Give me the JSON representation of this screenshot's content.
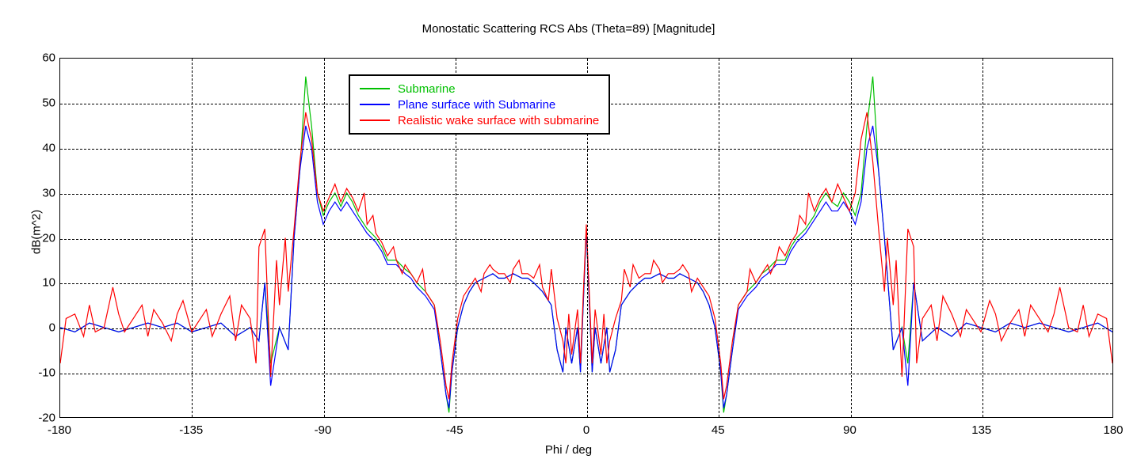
{
  "chart_data": {
    "type": "line",
    "title": "Monostatic Scattering RCS Abs (Theta=89) [Magnitude]",
    "xlabel": "Phi / deg",
    "ylabel": "dB(m^2)",
    "xlim": [
      -180,
      180
    ],
    "ylim": [
      -20,
      60
    ],
    "xticks": [
      -180,
      -135,
      -90,
      -45,
      0,
      45,
      90,
      135,
      180
    ],
    "yticks": [
      -20,
      -10,
      0,
      10,
      20,
      30,
      40,
      50,
      60
    ],
    "legend_position": "top-center",
    "grid": true,
    "series": [
      {
        "name": "Submarine",
        "color": "#00c000",
        "x": [
          -180,
          -175,
          -170,
          -165,
          -160,
          -155,
          -150,
          -145,
          -140,
          -135,
          -130,
          -125,
          -120,
          -115,
          -112,
          -110,
          -108,
          -105,
          -102,
          -100,
          -98,
          -96,
          -94,
          -92,
          -90,
          -88,
          -86,
          -84,
          -82,
          -80,
          -78,
          -75,
          -72,
          -70,
          -68,
          -65,
          -62,
          -60,
          -58,
          -55,
          -52,
          -50,
          -48,
          -47,
          -46,
          -45,
          -44,
          -42,
          -40,
          -38,
          -35,
          -32,
          -30,
          -28,
          -25,
          -22,
          -20,
          -18,
          -15,
          -12,
          -10,
          -8,
          -7,
          -5,
          -3,
          -2,
          0,
          2,
          3,
          5,
          7,
          8,
          10,
          12,
          15,
          18,
          20,
          22,
          25,
          28,
          30,
          32,
          35,
          38,
          40,
          42,
          44,
          45,
          46,
          47,
          48,
          50,
          52,
          55,
          58,
          60,
          62,
          65,
          68,
          70,
          72,
          75,
          78,
          80,
          82,
          84,
          86,
          88,
          90,
          92,
          94,
          96,
          98,
          100,
          102,
          105,
          108,
          110,
          112,
          115,
          120,
          125,
          130,
          135,
          140,
          145,
          150,
          155,
          160,
          165,
          170,
          175,
          180
        ],
        "values": [
          0,
          -1,
          1,
          0,
          -1,
          0,
          1,
          0,
          1,
          -1,
          0,
          1,
          -2,
          0,
          -3,
          10,
          -8,
          0,
          -5,
          20,
          35,
          56,
          45,
          30,
          25,
          28,
          30,
          27,
          30,
          28,
          25,
          22,
          20,
          18,
          15,
          15,
          13,
          12,
          10,
          8,
          5,
          -5,
          -15,
          -19,
          -10,
          -5,
          0,
          5,
          8,
          10,
          11,
          12,
          11,
          11,
          12,
          11,
          11,
          10,
          8,
          5,
          -5,
          -10,
          0,
          -8,
          0,
          -10,
          22,
          -10,
          0,
          -8,
          0,
          -10,
          -5,
          5,
          8,
          10,
          11,
          11,
          12,
          11,
          11,
          12,
          11,
          10,
          8,
          5,
          0,
          -5,
          -10,
          -19,
          -15,
          -5,
          5,
          8,
          10,
          12,
          13,
          15,
          15,
          18,
          20,
          22,
          25,
          28,
          30,
          28,
          27,
          30,
          28,
          25,
          30,
          45,
          56,
          35,
          20,
          -5,
          0,
          -8,
          10,
          -3,
          0,
          -2,
          1,
          0,
          -1,
          1,
          0,
          1,
          0,
          -1,
          0,
          1,
          -1,
          0
        ],
        "note": "RCS pattern symmetric about 0; sharp peaks ~±96° up to 56 dB; broad lobes ±80° region ~25-30 dB; dips near ±47° to ~-19 dB; narrow spike at 0° to ~22 dB; baseline ~0 dB beyond ±110°"
      },
      {
        "name": "Plane surface with Submarine",
        "color": "#0000ff",
        "x": [
          -180,
          -175,
          -170,
          -165,
          -160,
          -155,
          -150,
          -145,
          -140,
          -135,
          -130,
          -125,
          -120,
          -115,
          -112,
          -110,
          -108,
          -105,
          -102,
          -100,
          -98,
          -96,
          -94,
          -92,
          -90,
          -88,
          -86,
          -84,
          -82,
          -80,
          -78,
          -75,
          -72,
          -70,
          -68,
          -65,
          -62,
          -60,
          -58,
          -55,
          -52,
          -50,
          -48,
          -47,
          -46,
          -45,
          -44,
          -42,
          -40,
          -38,
          -35,
          -32,
          -30,
          -28,
          -25,
          -22,
          -20,
          -18,
          -15,
          -12,
          -10,
          -8,
          -7,
          -5,
          -3,
          -2,
          0,
          2,
          3,
          5,
          7,
          8,
          10,
          12,
          15,
          18,
          20,
          22,
          25,
          28,
          30,
          32,
          35,
          38,
          40,
          42,
          44,
          45,
          46,
          47,
          48,
          50,
          52,
          55,
          58,
          60,
          62,
          65,
          68,
          70,
          72,
          75,
          78,
          80,
          82,
          84,
          86,
          88,
          90,
          92,
          94,
          96,
          98,
          100,
          102,
          105,
          108,
          110,
          112,
          115,
          120,
          125,
          130,
          135,
          140,
          145,
          150,
          155,
          160,
          165,
          170,
          175,
          180
        ],
        "values": [
          0,
          -1,
          1,
          0,
          -1,
          0,
          1,
          0,
          1,
          -1,
          0,
          1,
          -2,
          0,
          -3,
          10,
          -13,
          0,
          -5,
          20,
          35,
          45,
          40,
          28,
          23,
          26,
          28,
          26,
          28,
          26,
          24,
          21,
          19,
          17,
          14,
          14,
          12,
          11,
          9,
          7,
          4,
          -5,
          -15,
          -18,
          -10,
          -5,
          0,
          5,
          8,
          10,
          11,
          12,
          11,
          11,
          12,
          11,
          11,
          10,
          8,
          5,
          -5,
          -10,
          0,
          -8,
          0,
          -10,
          22,
          -10,
          0,
          -8,
          0,
          -10,
          -5,
          5,
          8,
          10,
          11,
          11,
          12,
          11,
          11,
          12,
          11,
          10,
          8,
          5,
          0,
          -5,
          -10,
          -18,
          -15,
          -5,
          4,
          7,
          9,
          11,
          12,
          14,
          14,
          17,
          19,
          21,
          24,
          26,
          28,
          26,
          26,
          28,
          26,
          23,
          28,
          40,
          45,
          35,
          20,
          -5,
          0,
          -13,
          10,
          -3,
          0,
          -2,
          1,
          0,
          -1,
          1,
          0,
          1,
          0,
          -1,
          0,
          1,
          -1,
          0
        ],
        "note": "Closely overlaps Submarine but slightly lower amplitude on peaks and deeper notch near ±108°"
      },
      {
        "name": "Realistic wake surface with submarine",
        "color": "#ff0000",
        "x": [
          -180,
          -178,
          -175,
          -172,
          -170,
          -168,
          -165,
          -162,
          -160,
          -158,
          -155,
          -152,
          -150,
          -148,
          -145,
          -142,
          -140,
          -138,
          -135,
          -132,
          -130,
          -128,
          -125,
          -122,
          -120,
          -118,
          -115,
          -113,
          -112,
          -110,
          -108,
          -106,
          -105,
          -103,
          -102,
          -100,
          -98,
          -96,
          -94,
          -92,
          -90,
          -88,
          -86,
          -84,
          -82,
          -80,
          -78,
          -76,
          -75,
          -73,
          -72,
          -70,
          -68,
          -66,
          -65,
          -63,
          -62,
          -60,
          -58,
          -56,
          -55,
          -53,
          -52,
          -50,
          -48,
          -47,
          -46,
          -45,
          -44,
          -42,
          -40,
          -38,
          -36,
          -35,
          -33,
          -32,
          -30,
          -28,
          -26,
          -25,
          -23,
          -22,
          -20,
          -18,
          -16,
          -15,
          -13,
          -12,
          -10,
          -8,
          -7,
          -6,
          -5,
          -3,
          -2,
          -1,
          0,
          1,
          2,
          3,
          5,
          6,
          7,
          8,
          10,
          12,
          13,
          15,
          16,
          18,
          20,
          22,
          23,
          25,
          26,
          28,
          30,
          32,
          33,
          35,
          36,
          38,
          40,
          42,
          44,
          45,
          46,
          47,
          48,
          50,
          52,
          53,
          55,
          56,
          58,
          60,
          62,
          63,
          65,
          66,
          68,
          70,
          72,
          73,
          75,
          76,
          78,
          80,
          82,
          84,
          86,
          88,
          90,
          92,
          94,
          96,
          98,
          100,
          102,
          103,
          105,
          106,
          108,
          110,
          112,
          113,
          115,
          118,
          120,
          122,
          125,
          128,
          130,
          132,
          135,
          138,
          140,
          142,
          145,
          148,
          150,
          152,
          155,
          158,
          160,
          162,
          165,
          168,
          170,
          172,
          175,
          178,
          180
        ],
        "values": [
          -8,
          2,
          3,
          -2,
          5,
          -1,
          0,
          9,
          3,
          -1,
          2,
          5,
          -2,
          4,
          1,
          -3,
          3,
          6,
          -1,
          2,
          4,
          -2,
          3,
          7,
          -3,
          5,
          2,
          -8,
          18,
          22,
          -11,
          15,
          5,
          20,
          8,
          22,
          37,
          48,
          42,
          30,
          26,
          29,
          32,
          28,
          31,
          29,
          26,
          30,
          23,
          25,
          21,
          19,
          16,
          18,
          15,
          12,
          14,
          12,
          10,
          13,
          8,
          6,
          5,
          -3,
          -13,
          -16,
          -8,
          -3,
          2,
          7,
          9,
          11,
          8,
          12,
          14,
          13,
          12,
          12,
          10,
          13,
          15,
          12,
          12,
          11,
          14,
          9,
          6,
          13,
          2,
          -3,
          -8,
          3,
          -6,
          4,
          -8,
          8,
          23,
          8,
          -8,
          4,
          -6,
          3,
          -8,
          -3,
          2,
          6,
          13,
          9,
          14,
          11,
          12,
          12,
          15,
          13,
          10,
          12,
          12,
          13,
          14,
          12,
          8,
          11,
          9,
          7,
          2,
          -3,
          -8,
          -16,
          -13,
          -3,
          5,
          6,
          8,
          13,
          10,
          12,
          14,
          12,
          15,
          18,
          16,
          19,
          21,
          25,
          23,
          30,
          26,
          29,
          31,
          28,
          32,
          29,
          26,
          30,
          42,
          48,
          37,
          22,
          8,
          20,
          5,
          15,
          -11,
          22,
          18,
          -8,
          2,
          5,
          -3,
          7,
          3,
          -2,
          4,
          2,
          -1,
          6,
          3,
          -3,
          1,
          4,
          -2,
          5,
          2,
          -1,
          3,
          9,
          0,
          -1,
          5,
          -2,
          3,
          2,
          -8
        ],
        "note": "Noisier fluctuation over Submarine envelope; extra spikes near ±112°/±155°; peaks ±96° reach ~48 dB; elevated ripple 3-9 dB beyond ±110° vs baseline 0"
      }
    ]
  }
}
